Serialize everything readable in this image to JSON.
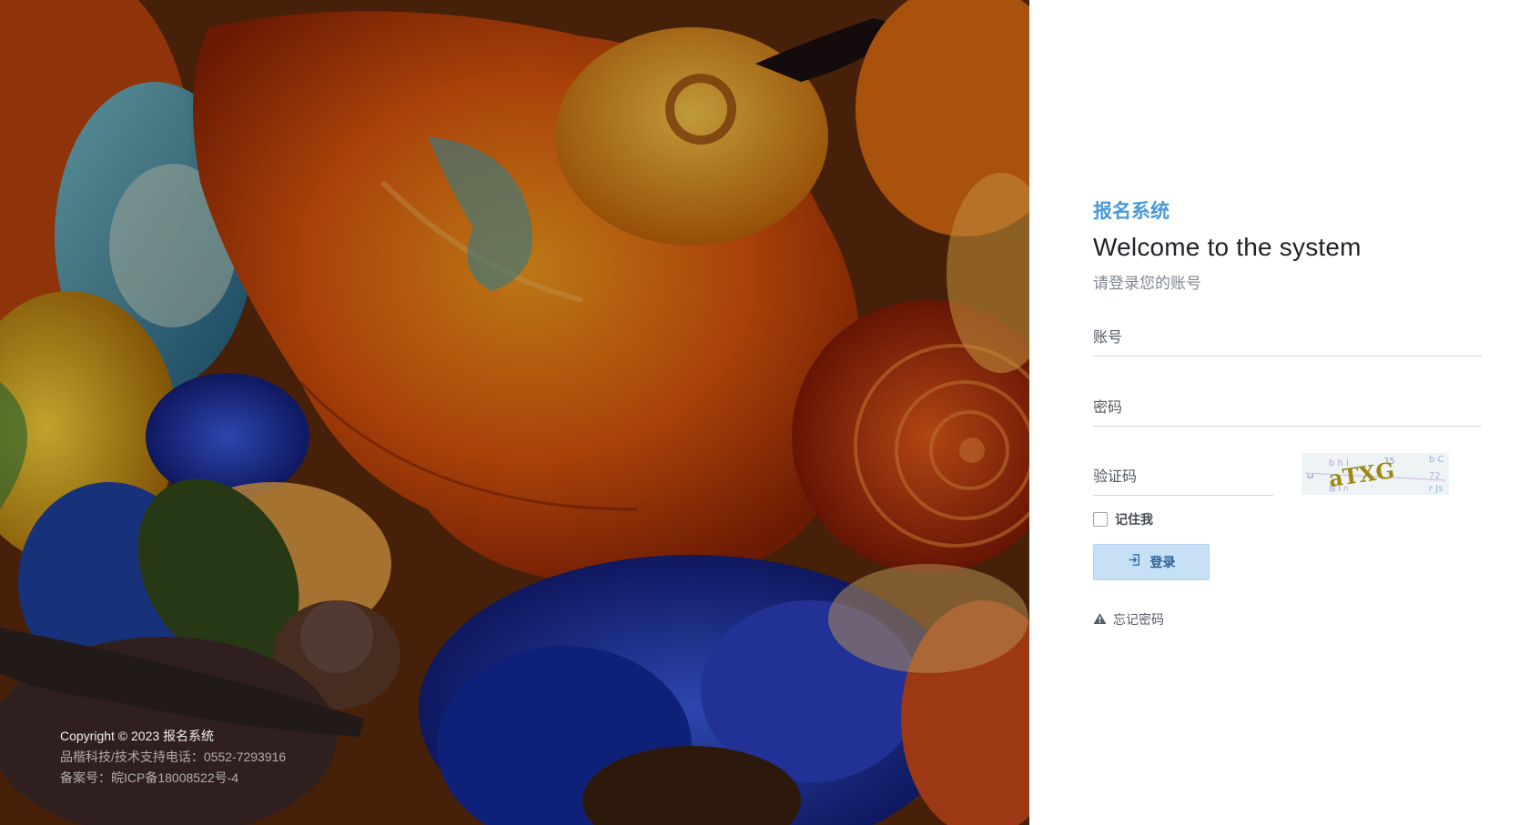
{
  "left_panel": {
    "footer": {
      "copyright": "Copyright © 2023 报名系统",
      "support": "品楷科技/技术支持电话：0552-7293916",
      "icp": "备案号：皖ICP备18008522号-4"
    }
  },
  "login": {
    "brand": "报名系统",
    "welcome": "Welcome to the system",
    "subtitle": "请登录您的账号",
    "account_placeholder": "账号",
    "password_placeholder": "密码",
    "captcha_placeholder": "验证码",
    "captcha_text": "aTXG",
    "remember_label": "记住我",
    "remember_checked": false,
    "login_button": "登录",
    "forgot_label": "忘记密码"
  },
  "icons": {
    "login_button_icon": "sign-in-icon",
    "forgot_icon": "warning-triangle-icon"
  },
  "colors": {
    "brand": "#4a9ad8",
    "button_bg": "#c6e1f5",
    "button_text": "#2c5f95"
  }
}
